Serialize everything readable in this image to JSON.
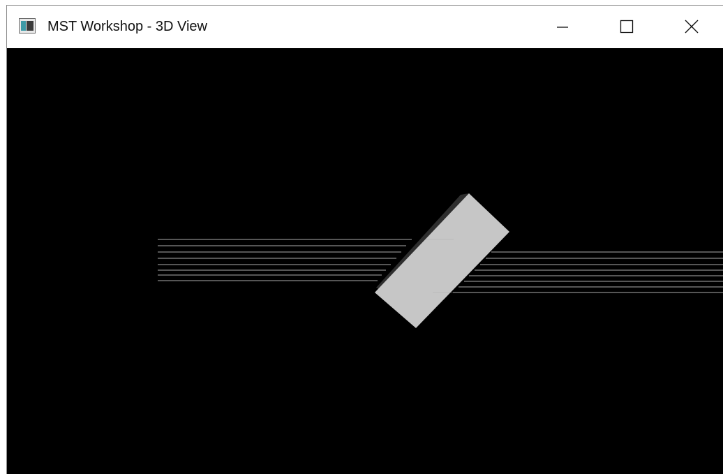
{
  "window": {
    "title": "MST Workshop - 3D View",
    "app_icon": "app-window-icon",
    "controls": {
      "minimize_icon": "minimize-icon",
      "maximize_icon": "maximize-icon",
      "close_icon": "close-icon"
    }
  },
  "viewport": {
    "background_color": "#000000",
    "object_color": "#c6c6c6",
    "object_edge_color": "#2e2e2e",
    "ray_color": "#8a8a8a"
  }
}
